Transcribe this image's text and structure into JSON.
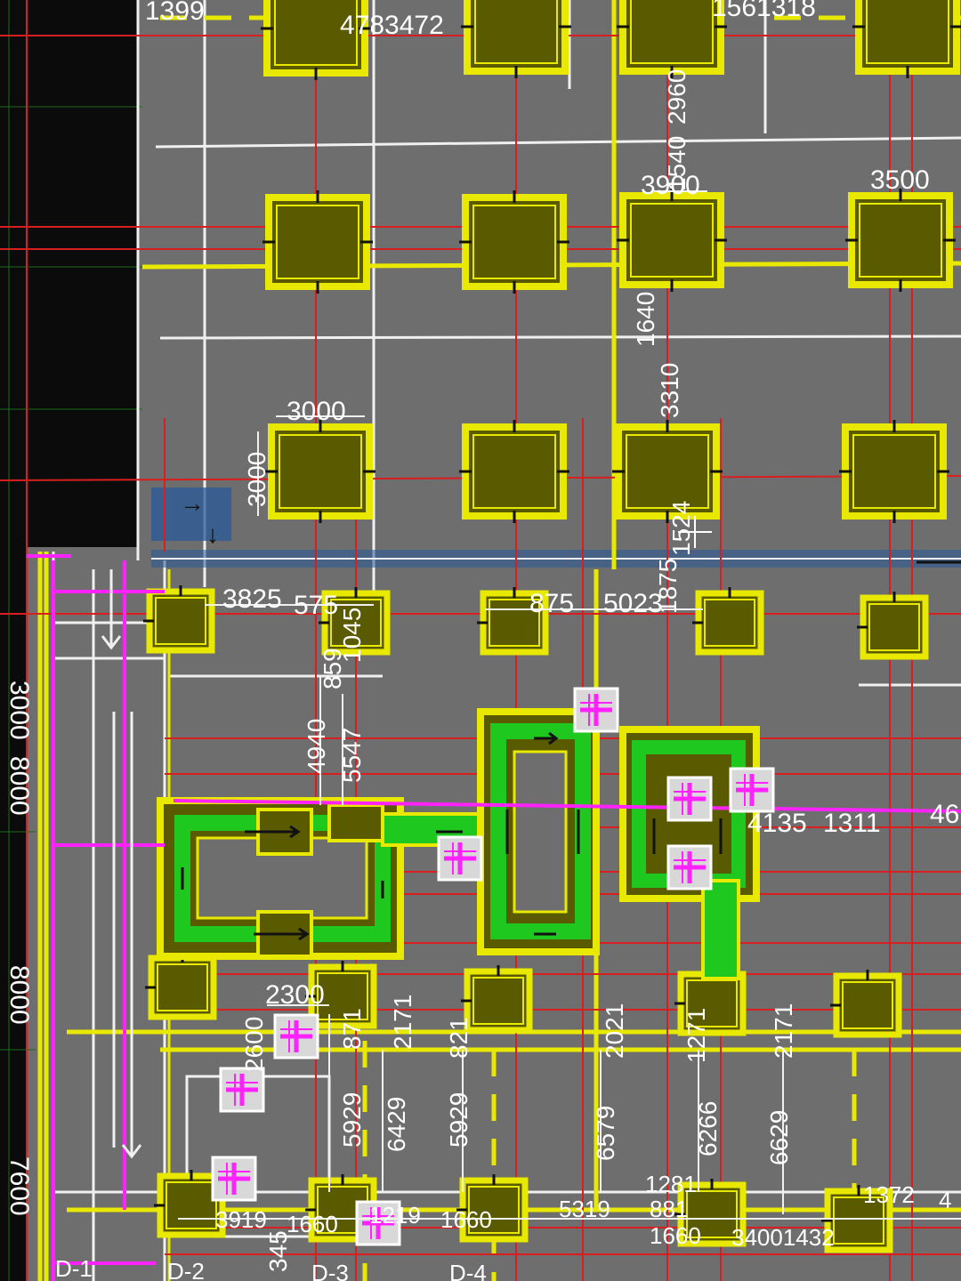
{
  "colors": {
    "background": "#6e6e6e",
    "outer_void": "#0b0b0b",
    "column_fill": "#5a5a00",
    "column_outline": "#e8e800",
    "beam_line": "#e8e800",
    "grid_red": "#d81e1e",
    "grid_white": "#f0f0f0",
    "magenta": "#ff22ff",
    "core_green": "#1ec81e",
    "selection_blue": "#2a5a9a"
  },
  "icons": {
    "cursor": "crosshair-cursor-icon",
    "arrow_right": "arrow-right-icon",
    "arrow_down": "arrow-down-icon",
    "shaft_marker": "magenta-cross-marker-icon"
  },
  "top_labels": {
    "top_left": "1399",
    "top_mid": "4783472",
    "top_right": "1561318"
  },
  "dimensions": {
    "col_top_2960": "2960",
    "col_top_1540": "1540",
    "col_top_3900": "3900",
    "col_top_3500": "3500",
    "col_1640": "1640",
    "col_3310": "3310",
    "col_3000_h": "3000",
    "col_3000_v": "3000",
    "row_3825": "3825",
    "row_575": "575",
    "row_875": "875",
    "row_5023": "5023",
    "row_1524": "1524",
    "row_1875": "1875",
    "v_859": "859",
    "v_1045": "1045",
    "v_4940": "4940",
    "v_5547": "5547",
    "row_4135": "4135",
    "row_1311": "1311",
    "row_46": "46",
    "c_2300": "2300",
    "c_2600": "2600",
    "c_871": "871",
    "c_2171": "2171",
    "c_821": "821",
    "c_2021": "2021",
    "c_1271": "1271",
    "c_2171b": "2171",
    "c_5929": "5929",
    "c_6429": "6429",
    "c_5929b": "5929",
    "c_6579": "6579",
    "c_6266": "6266",
    "c_6629": "6629",
    "b_3919": "3919",
    "b_1660": "1660",
    "b_1219": "1219",
    "b_1660b": "1660",
    "b_5319": "5319",
    "b_881": "881",
    "b_1281": "1281",
    "b_1660c": "1660",
    "b_3400": "34001432",
    "b_1372": "1372",
    "b_4": "4",
    "b_345": "345"
  },
  "ruler": {
    "r1": "3000",
    "r2": "8000",
    "r3": "8000",
    "r4": "7600"
  },
  "axis_labels": {
    "d1": "D-1",
    "d2": "D-2",
    "d3": "D-3",
    "d4": "D-4"
  }
}
